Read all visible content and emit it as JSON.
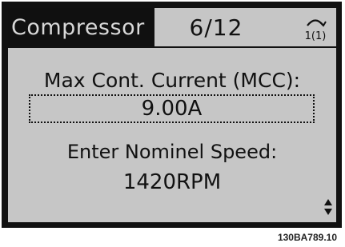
{
  "header": {
    "title": "Compressor",
    "counter": "6/12",
    "setup_icon": "setup-1-icon",
    "setup_label": "1(1)"
  },
  "parameter": {
    "label": "Max Cont. Current (MCC):",
    "value": "9.00A"
  },
  "info": {
    "label": "Enter Nominel Speed:",
    "value": "1420RPM"
  },
  "scroll_icon": "up-down-arrow-icon",
  "figure_code": "130BA789.10",
  "colors": {
    "screen": "#c6c6c6",
    "frame": "#111111",
    "text": "#111111"
  }
}
